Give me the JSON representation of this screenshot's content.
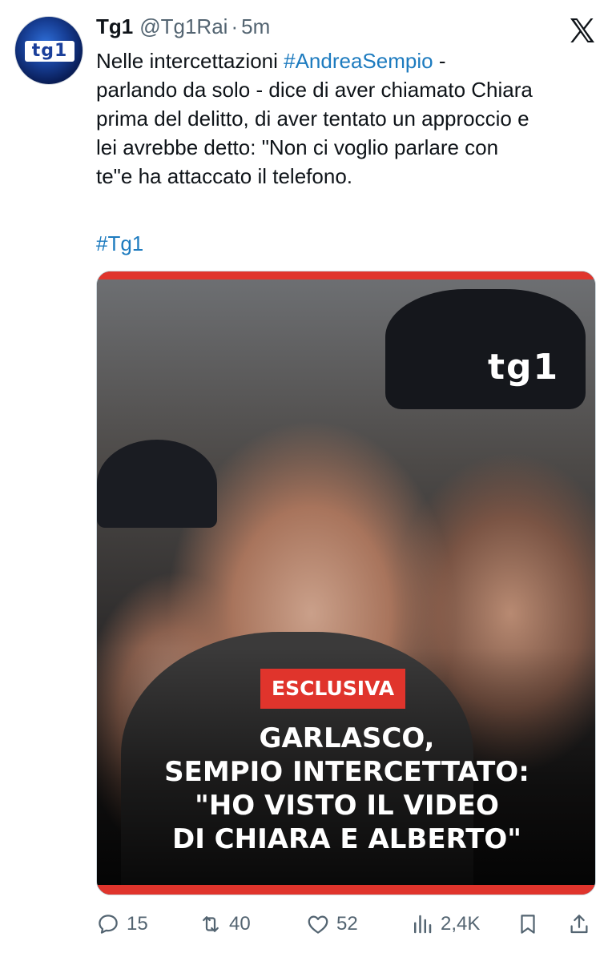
{
  "tweet": {
    "display_name": "Tg1",
    "handle": "@Tg1Rai",
    "separator": "·",
    "time": "5m",
    "avatar_text": "tg1",
    "text_lines": [
      {
        "plain": "Nelle intercettazioni ",
        "hashtag": "#AndreaSempio",
        "after": " -"
      },
      {
        "plain": "parlando da solo - dice di aver chiamato Chiara"
      },
      {
        "plain": "prima del delitto, di aver tentato un approccio e"
      },
      {
        "plain": "lei avrebbe detto: \"Non ci voglio parlare con"
      },
      {
        "plain": "te\"e ha attaccato il telefono."
      }
    ],
    "hashtag_line": "#Tg1"
  },
  "media": {
    "watermark": "tg1",
    "badge": "ESCLUSIVA",
    "headline": [
      "GARLASCO,",
      "SEMPIO INTERCETTATO:",
      "\"HO VISTO IL VIDEO",
      "DI CHIARA E ALBERTO\""
    ]
  },
  "actions": {
    "replies": "15",
    "reposts": "40",
    "likes": "52",
    "views": "2,4K"
  },
  "icons": {
    "brand": "x-logo-icon",
    "reply": "reply-icon",
    "repost": "repost-icon",
    "like": "heart-icon",
    "views": "views-icon",
    "bookmark": "bookmark-icon",
    "share": "share-icon"
  },
  "colors": {
    "text": "#0f1419",
    "secondary": "#536471",
    "link": "#1d7bbf",
    "accent_red": "#e0342c"
  }
}
